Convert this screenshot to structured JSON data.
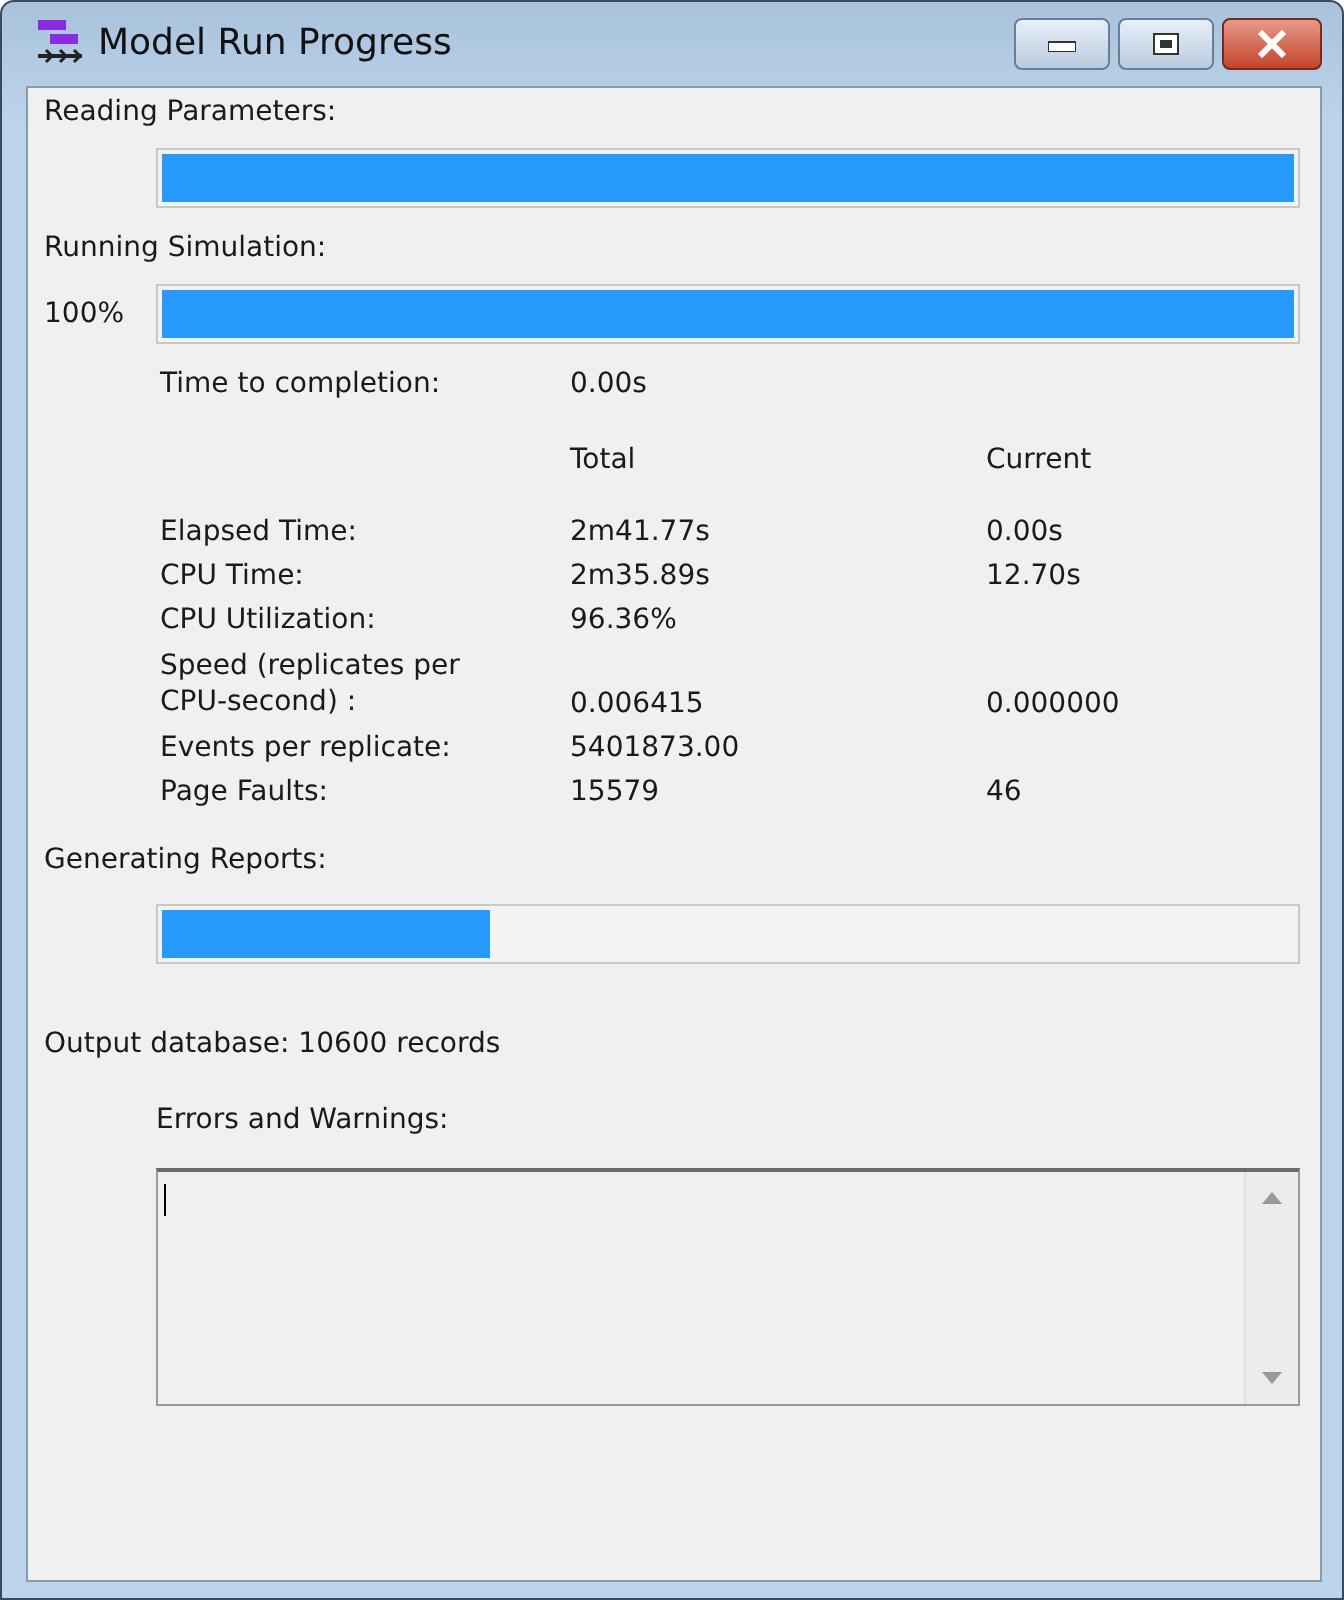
{
  "window": {
    "title": "Model Run Progress"
  },
  "reading": {
    "label": "Reading Parameters:",
    "level": 1
  },
  "simulation": {
    "label": "Running Simulation:",
    "percent": "100%",
    "level": 1,
    "completion_label": "Time to completion:",
    "completion_value": "0.00s"
  },
  "stats": {
    "columns": [
      "Total",
      "Current"
    ],
    "rows": [
      {
        "label": "Elapsed Time:",
        "total": "2m41.77s",
        "current": "0.00s"
      },
      {
        "label": "CPU Time:",
        "total": "2m35.89s",
        "current": "12.70s"
      },
      {
        "label": "CPU Utilization:",
        "total": "96.36%"
      },
      {
        "label": "Speed (replicates per CPU-second) :",
        "total": "0.006415",
        "current": "0.000000"
      },
      {
        "label": "Events per replicate:",
        "total": "5401873.00"
      },
      {
        "label": "Page Faults:",
        "total": "15579",
        "current": "46"
      }
    ]
  },
  "reports": {
    "label": "Generating Reports:",
    "level": 0.29
  },
  "output": "Output database: 10600 records",
  "errors": {
    "label": "Errors and Warnings:"
  }
}
